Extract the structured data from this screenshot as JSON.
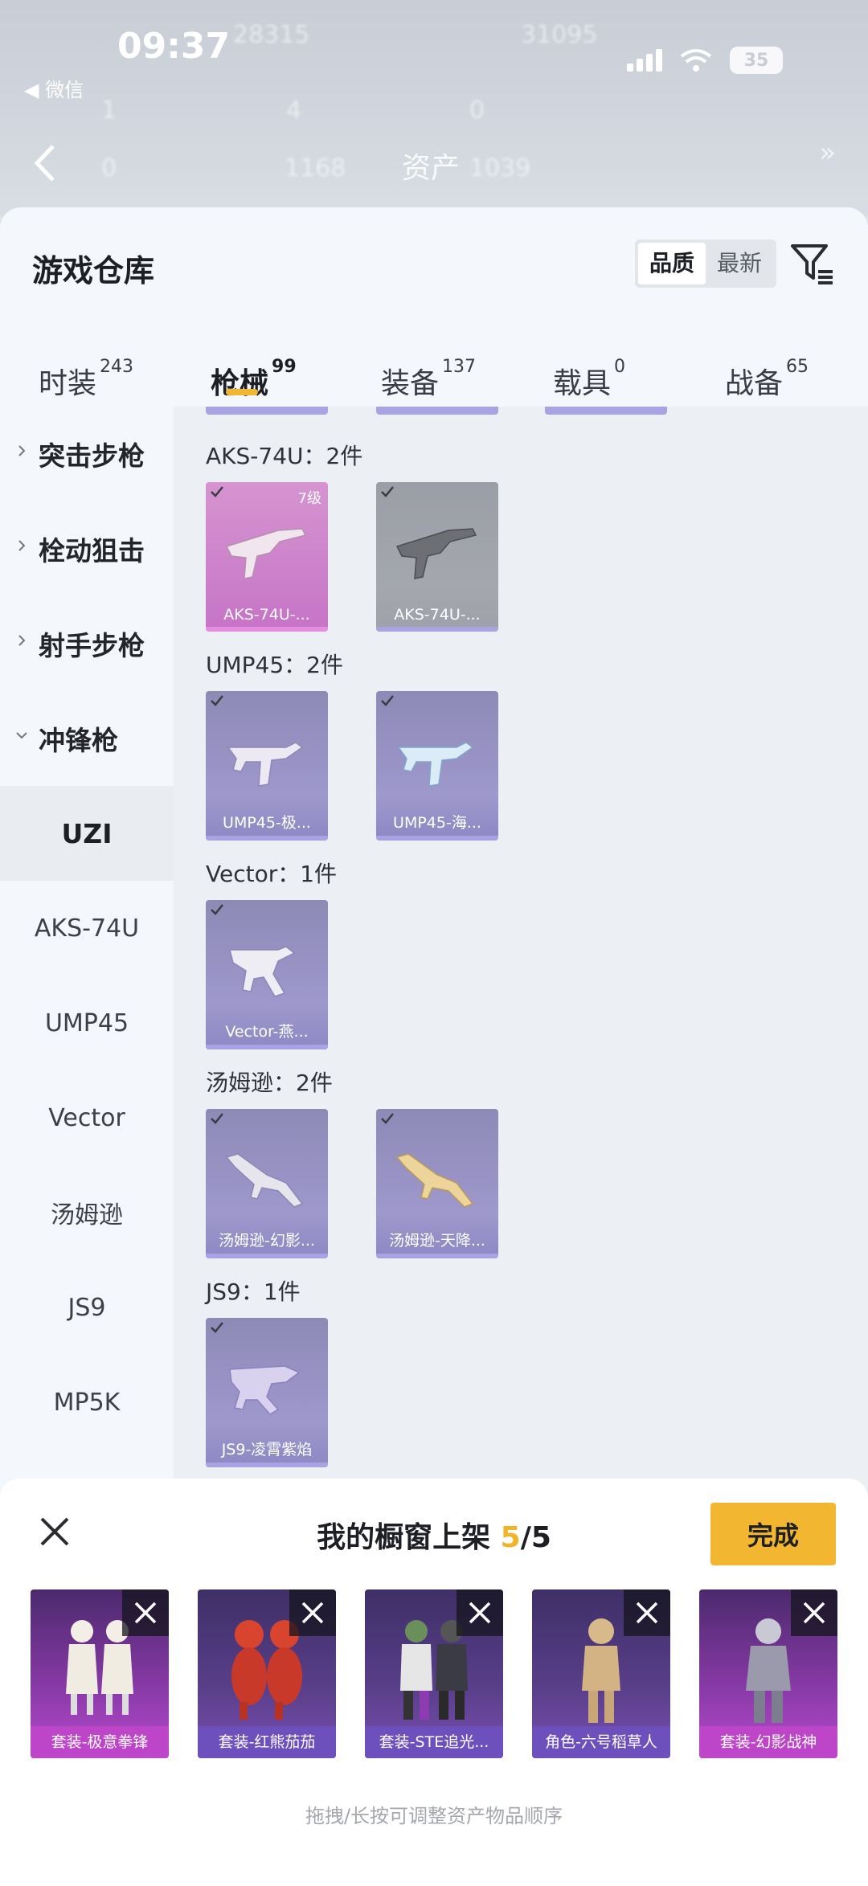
{
  "status": {
    "time": "09:37",
    "back_app": "◀ 微信",
    "battery": "35"
  },
  "nav": {
    "title": "资产",
    "ghost_values": [
      "28315",
      "31095",
      "1",
      "4",
      "0",
      "0",
      "1168",
      "1039"
    ]
  },
  "warehouse": {
    "title": "游戏仓库",
    "sort_options": [
      "品质",
      "最新"
    ],
    "tabs": [
      {
        "label": "时装",
        "count": "243"
      },
      {
        "label": "枪械",
        "count": "99"
      },
      {
        "label": "装备",
        "count": "137"
      },
      {
        "label": "载具",
        "count": "0"
      },
      {
        "label": "战备",
        "count": "65"
      }
    ],
    "groups": [
      "突击步枪",
      "栓动狙击",
      "射手步枪",
      "冲锋枪"
    ],
    "sub_items": [
      "UZI",
      "AKS-74U",
      "UMP45",
      "Vector",
      "汤姆逊",
      "JS9",
      "MP5K"
    ],
    "sections": [
      {
        "label": "AKS-74U：2件",
        "items": [
          {
            "name": "AKS-74U-...",
            "level": "7级",
            "style": "pink"
          },
          {
            "name": "AKS-74U-...",
            "level": "",
            "style": "gray"
          }
        ]
      },
      {
        "label": "UMP45：2件",
        "items": [
          {
            "name": "UMP45-极...",
            "level": "",
            "style": "purple"
          },
          {
            "name": "UMP45-海...",
            "level": "",
            "style": "purple"
          }
        ]
      },
      {
        "label": "Vector：1件",
        "items": [
          {
            "name": "Vector-燕...",
            "level": "",
            "style": "purple"
          }
        ]
      },
      {
        "label": "汤姆逊：2件",
        "items": [
          {
            "name": "汤姆逊-幻影...",
            "level": "",
            "style": "purple"
          },
          {
            "name": "汤姆逊-天降...",
            "level": "",
            "style": "purple"
          }
        ]
      },
      {
        "label": "JS9：1件",
        "items": [
          {
            "name": "JS9-凌霄紫焰",
            "level": "",
            "style": "purple"
          }
        ]
      }
    ]
  },
  "showcase": {
    "title_prefix": "我的橱窗上架 ",
    "count": "5",
    "total": "/5",
    "done_label": "完成",
    "items": [
      {
        "label": "套装-极意拳锋",
        "style": "magenta"
      },
      {
        "label": "套装-红熊茄茄",
        "style": "purple"
      },
      {
        "label": "套装-STE追光...",
        "style": "purple"
      },
      {
        "label": "角色-六号稻草人",
        "style": "purple"
      },
      {
        "label": "套装-幻影战神",
        "style": "magenta"
      }
    ],
    "hint": "拖拽/长按可调整资产物品顺序"
  },
  "colors": {
    "accent": "#f3b631",
    "card_purple": "#9e98cc",
    "card_pink": "#ca7ec9"
  }
}
